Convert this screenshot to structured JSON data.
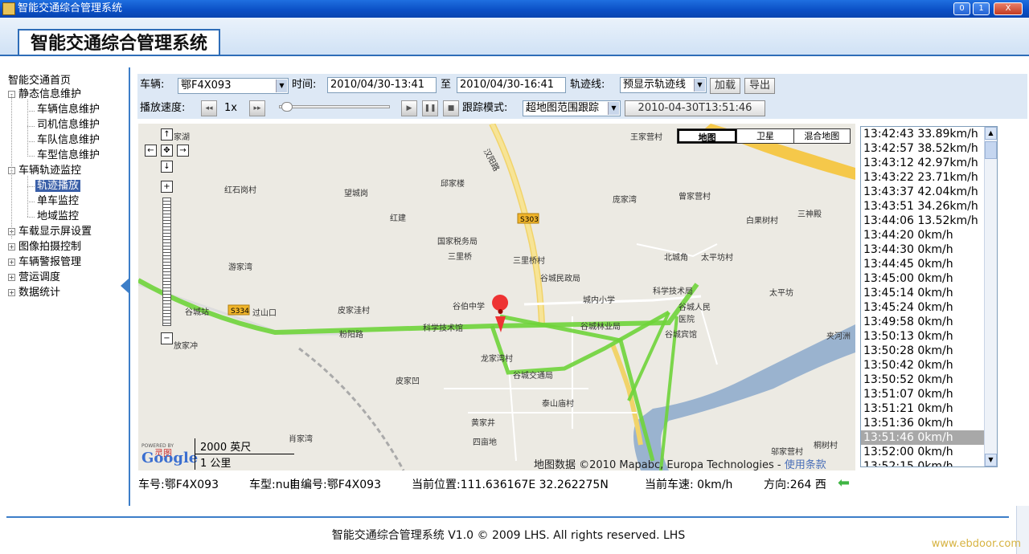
{
  "window": {
    "title": "智能交通综合管理系统",
    "min": "0",
    "max": "1",
    "close": "X"
  },
  "header": {
    "title": "智能交通综合管理系统"
  },
  "sidebar": {
    "items": [
      {
        "label": "智能交通首页"
      },
      {
        "label": "静态信息维护"
      },
      {
        "label": "车辆信息维护"
      },
      {
        "label": "司机信息维护"
      },
      {
        "label": "车队信息维护"
      },
      {
        "label": "车型信息维护"
      },
      {
        "label": "车辆轨迹监控"
      },
      {
        "label": "轨迹播放"
      },
      {
        "label": "单车监控"
      },
      {
        "label": "地域监控"
      },
      {
        "label": "车载显示屏设置"
      },
      {
        "label": "图像拍摄控制"
      },
      {
        "label": "车辆警报管理"
      },
      {
        "label": "营运调度"
      },
      {
        "label": "数据统计"
      }
    ]
  },
  "controls": {
    "vehicle_label": "车辆:",
    "vehicle_value": "鄂F4X093",
    "time_label": "时间:",
    "time_from": "2010/04/30-13:41",
    "to_label": "至",
    "time_to": "2010/04/30-16:41",
    "track_label": "轨迹线:",
    "track_value": "预显示轨迹线",
    "load_btn": "加载",
    "export_btn": "导出",
    "speed_label": "播放速度:",
    "speed_value": "1x",
    "rewind": "◂◂",
    "forward": "▸▸",
    "play": "▶",
    "pause": "❚❚",
    "stop": "■",
    "follow_label": "跟踪模式:",
    "follow_value": "超地图范围跟踪",
    "timestamp": "2010-04-30T13:51:46"
  },
  "map": {
    "types": [
      "地图",
      "卫星",
      "混合地图"
    ],
    "places": [
      "家湖",
      "王家营村",
      "红石岗村",
      "望城岗",
      "邱家楼",
      "庞家湾",
      "曾家营村",
      "三神殿",
      "白果树村",
      "红建",
      "国家税务局",
      "三里桥",
      "三里桥村",
      "北城角",
      "太平坊村",
      "游家湾",
      "谷城民政局",
      "科学技术局",
      "太平坊",
      "谷城站",
      "过山口",
      "皮家洼村",
      "谷伯中学",
      "城内小学",
      "谷城人民医院",
      "科学技术馆",
      "谷城林业局",
      "谷城宾馆",
      "放家冲",
      "粉阳路",
      "龙家湾村",
      "夹河洲",
      "谷城交通局",
      "皮家凹",
      "泰山庙村",
      "黄家井",
      "肖家湾",
      "四亩地",
      "邬家营村",
      "桐树村",
      "汉阳路"
    ],
    "roads": [
      "S303",
      "S334"
    ],
    "scale_imperial": "2000 英尺",
    "scale_metric": "1 公里",
    "copyright": "地图数据 ©2010 Mapabc, Europa Technologies -",
    "terms": "使用条款",
    "powered": "POWERED BY",
    "brand_cn": "灵图",
    "brand": "Google"
  },
  "track_points": [
    "13:42:43 33.89km/h",
    "13:42:57 38.52km/h",
    "13:43:12 42.97km/h",
    "13:43:22 23.71km/h",
    "13:43:37 42.04km/h",
    "13:43:51 34.26km/h",
    "13:44:06 13.52km/h",
    "13:44:20 0km/h",
    "13:44:30 0km/h",
    "13:44:45 0km/h",
    "13:45:00 0km/h",
    "13:45:14 0km/h",
    "13:45:24 0km/h",
    "13:49:58 0km/h",
    "13:50:13 0km/h",
    "13:50:28 0km/h",
    "13:50:42 0km/h",
    "13:50:52 0km/h",
    "13:51:07 0km/h",
    "13:51:21 0km/h",
    "13:51:36 0km/h",
    "13:51:46 0km/h",
    "13:52:00 0km/h",
    "13:52:15 0km/h"
  ],
  "status": {
    "plate": "车号:鄂F4X093",
    "type": "车型:null",
    "self_no": "自编号:鄂F4X093",
    "position": "当前位置:111.636167E 32.262275N",
    "speed": "当前车速: 0km/h",
    "direction": "方向:264 西"
  },
  "footer": {
    "text": "智能交通综合管理系统 V1.0 © 2009 LHS. All rights reserved. LHS",
    "watermark": "www.ebdoor.com"
  }
}
